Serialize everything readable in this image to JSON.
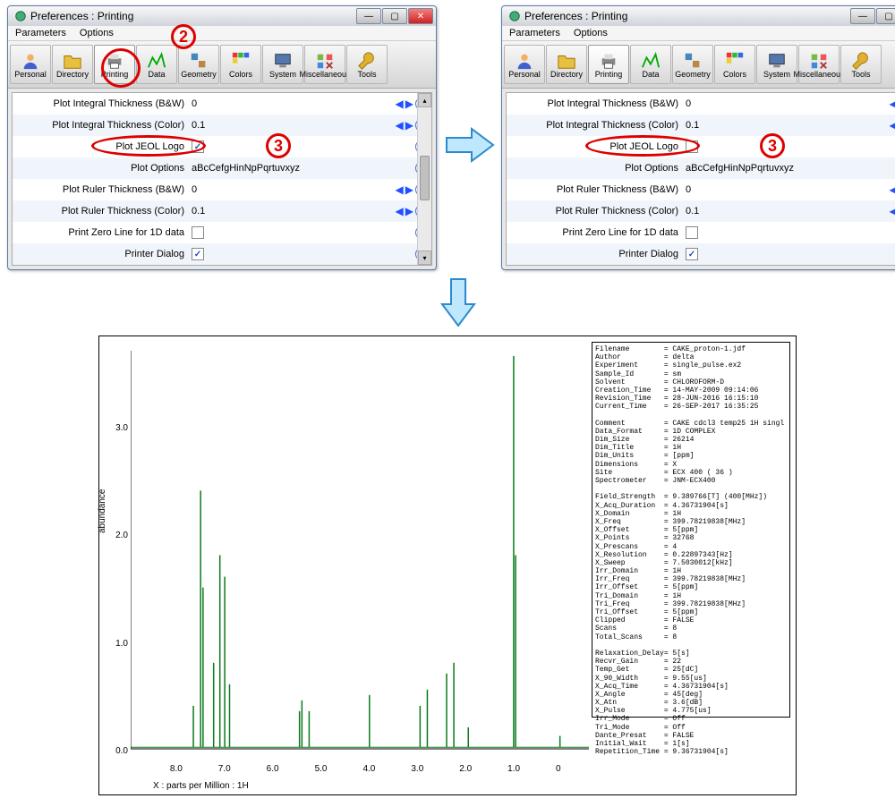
{
  "window": {
    "title": "Preferences : Printing",
    "menu": [
      "Parameters",
      "Options"
    ],
    "toolbar": [
      "Personal",
      "Directory",
      "Printing",
      "Data",
      "Geometry",
      "Colors",
      "System",
      "Miscellaneous",
      "Tools"
    ]
  },
  "prefs": [
    {
      "label": "Plot Integral Thickness (B&W)",
      "value": "0",
      "arrows": true
    },
    {
      "label": "Plot Integral Thickness (Color)",
      "value": "0.1",
      "arrows": true
    },
    {
      "label": "Plot JEOL Logo",
      "type": "check"
    },
    {
      "label": "Plot Options",
      "value": "aBcCefgHinNpPqrtuvxyz"
    },
    {
      "label": "Plot Ruler Thickness (B&W)",
      "value": "0",
      "arrows": true
    },
    {
      "label": "Plot Ruler Thickness (Color)",
      "value": "0.1",
      "arrows": true
    },
    {
      "label": "Print Zero Line for 1D data",
      "type": "check"
    },
    {
      "label": "Printer Dialog",
      "type": "check",
      "checked": true
    }
  ],
  "left_logo_checked": true,
  "right_logo_checked": false,
  "annotations": {
    "step2": "2",
    "step3": "3"
  },
  "plot": {
    "xlabel": "X : parts per Million : 1H",
    "ylabel": "abundance"
  },
  "chart_data": {
    "type": "line",
    "title": "",
    "xlabel": "X : parts per Million : 1H",
    "ylabel": "abundance",
    "xlim": [
      9,
      -0.5
    ],
    "ylim": [
      0,
      3.7
    ],
    "x_ticks": [
      8.0,
      7.0,
      6.0,
      5.0,
      4.0,
      3.0,
      2.0,
      1.0,
      0
    ],
    "y_ticks": [
      0,
      1.0,
      2.0,
      3.0
    ],
    "peaks": [
      {
        "ppm": 7.7,
        "h": 0.4
      },
      {
        "ppm": 7.55,
        "h": 2.4
      },
      {
        "ppm": 7.5,
        "h": 1.5
      },
      {
        "ppm": 7.28,
        "h": 0.8
      },
      {
        "ppm": 7.15,
        "h": 1.8
      },
      {
        "ppm": 7.05,
        "h": 1.6
      },
      {
        "ppm": 6.95,
        "h": 0.6
      },
      {
        "ppm": 5.5,
        "h": 0.35
      },
      {
        "ppm": 5.45,
        "h": 0.45
      },
      {
        "ppm": 5.3,
        "h": 0.35
      },
      {
        "ppm": 4.05,
        "h": 0.5
      },
      {
        "ppm": 3.0,
        "h": 0.4
      },
      {
        "ppm": 2.85,
        "h": 0.55
      },
      {
        "ppm": 2.45,
        "h": 0.7
      },
      {
        "ppm": 2.3,
        "h": 0.8
      },
      {
        "ppm": 2.0,
        "h": 0.2
      },
      {
        "ppm": 1.06,
        "h": 3.65
      },
      {
        "ppm": 1.02,
        "h": 1.8
      },
      {
        "ppm": 0.1,
        "h": 0.12
      }
    ]
  },
  "params_block1": [
    [
      "Filename",
      "CAKE_proton-1.jdf"
    ],
    [
      "Author",
      "delta"
    ],
    [
      "Experiment",
      "single_pulse.ex2"
    ],
    [
      "Sample_Id",
      "sm"
    ],
    [
      "Solvent",
      "CHLOROFORM-D"
    ],
    [
      "Creation_Time",
      "14-MAY-2009 09:14:06"
    ],
    [
      "Revision_Time",
      "28-JUN-2016 16:15:10"
    ],
    [
      "Current_Time",
      "26-SEP-2017 16:35:25"
    ]
  ],
  "params_block2": [
    [
      "Comment",
      "CAKE cdcl3 temp25 1H singl"
    ],
    [
      "Data_Format",
      "1D COMPLEX"
    ],
    [
      "Dim_Size",
      "26214"
    ],
    [
      "Dim_Title",
      "1H"
    ],
    [
      "Dim_Units",
      "[ppm]"
    ],
    [
      "Dimensions",
      "X"
    ],
    [
      "Site",
      "ECX 400 ( 36 )"
    ],
    [
      "Spectrometer",
      "JNM-ECX400"
    ]
  ],
  "params_block3": [
    [
      "Field_Strength",
      "9.389766[T] (400[MHz])"
    ],
    [
      "X_Acq_Duration",
      "4.36731904[s]"
    ],
    [
      "X_Domain",
      "1H"
    ],
    [
      "X_Freq",
      "399.78219838[MHz]"
    ],
    [
      "X_Offset",
      "5[ppm]"
    ],
    [
      "X_Points",
      "32768"
    ],
    [
      "X_Prescans",
      "4"
    ],
    [
      "X_Resolution",
      "0.22897343[Hz]"
    ],
    [
      "X_Sweep",
      "7.5030012[kHz]"
    ],
    [
      "Irr_Domain",
      "1H"
    ],
    [
      "Irr_Freq",
      "399.78219838[MHz]"
    ],
    [
      "Irr_Offset",
      "5[ppm]"
    ],
    [
      "Tri_Domain",
      "1H"
    ],
    [
      "Tri_Freq",
      "399.78219838[MHz]"
    ],
    [
      "Tri_Offset",
      "5[ppm]"
    ],
    [
      "Clipped",
      "FALSE"
    ],
    [
      "Scans",
      "8"
    ],
    [
      "Total_Scans",
      "8"
    ]
  ],
  "params_block4": [
    [
      "Relaxation_Delay",
      "5[s]"
    ],
    [
      "Recvr_Gain",
      "22"
    ],
    [
      "Temp_Get",
      "25[dC]"
    ],
    [
      "X_90_Width",
      "9.55[us]"
    ],
    [
      "X_Acq_Time",
      "4.36731904[s]"
    ],
    [
      "X_Angle",
      "45[deg]"
    ],
    [
      "X_Atn",
      "3.6[dB]"
    ],
    [
      "X_Pulse",
      "4.775[us]"
    ],
    [
      "Irr_Mode",
      "Off"
    ],
    [
      "Tri_Mode",
      "Off"
    ],
    [
      "Dante_Presat",
      "FALSE"
    ],
    [
      "Initial_Wait",
      "1[s]"
    ],
    [
      "Repetition_Time",
      "9.36731904[s]"
    ]
  ]
}
